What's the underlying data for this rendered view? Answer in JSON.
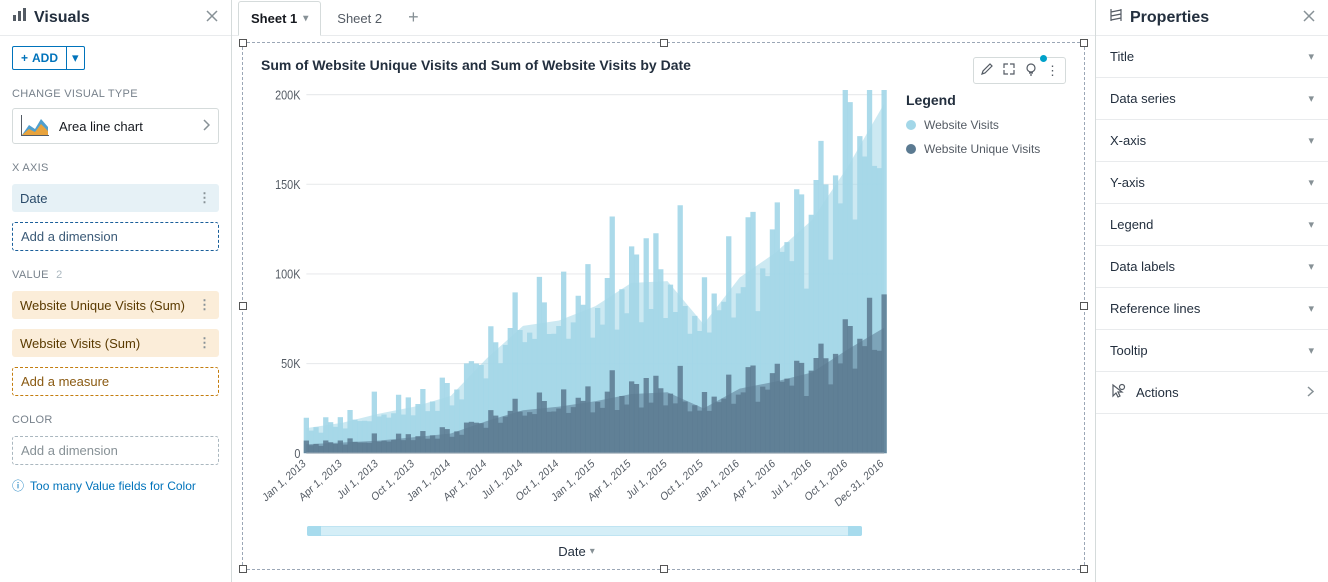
{
  "left": {
    "title": "Visuals",
    "add_label": "ADD",
    "change_type_label": "CHANGE VISUAL TYPE",
    "visual_type": "Area line chart",
    "xaxis_label": "X AXIS",
    "xaxis_field": "Date",
    "xaxis_add": "Add a dimension",
    "value_label": "VALUE",
    "value_count": "2",
    "value_fields": [
      "Website Unique Visits (Sum)",
      "Website Visits (Sum)"
    ],
    "value_add": "Add a measure",
    "color_label": "COLOR",
    "color_placeholder": "Add a dimension",
    "color_info": "Too many Value fields for Color"
  },
  "tabs": {
    "sheet1": "Sheet 1",
    "sheet2": "Sheet 2"
  },
  "chart": {
    "title": "Sum of Website Unique Visits and Sum of Website Visits by Date",
    "legend_title": "Legend",
    "series1_name": "Website Visits",
    "series2_name": "Website Unique Visits",
    "xaxis_title": "Date"
  },
  "props": {
    "title": "Properties",
    "items": [
      "Title",
      "Data series",
      "X-axis",
      "Y-axis",
      "Legend",
      "Data labels",
      "Reference lines",
      "Tooltip"
    ],
    "actions": "Actions"
  },
  "chart_data": {
    "type": "area",
    "title": "Sum of Website Unique Visits and Sum of Website Visits by Date",
    "xlabel": "Date",
    "ylabel": "",
    "ylim": [
      0,
      200000
    ],
    "yticks": [
      "0",
      "50K",
      "100K",
      "150K",
      "200K"
    ],
    "x_categories": [
      "Jan 1, 2013",
      "Apr 1, 2013",
      "Jul 1, 2013",
      "Oct 1, 2013",
      "Jan 1, 2014",
      "Apr 1, 2014",
      "Jul 1, 2014",
      "Oct 1, 2014",
      "Jan 1, 2015",
      "Apr 1, 2015",
      "Jul 1, 2015",
      "Oct 1, 2015",
      "Jan 1, 2016",
      "Apr 1, 2016",
      "Jul 1, 2016",
      "Oct 1, 2016",
      "Dec 31, 2016"
    ],
    "series": [
      {
        "name": "Website Visits",
        "color": "#a3d7e8",
        "values": [
          14000,
          17000,
          22000,
          26000,
          32000,
          53000,
          71000,
          74000,
          82000,
          95000,
          96000,
          72000,
          98000,
          112000,
          130000,
          160000,
          195000
        ]
      },
      {
        "name": "Website Unique Visits",
        "color": "#5b7a91",
        "values": [
          5000,
          6000,
          7000,
          9000,
          11000,
          18000,
          24000,
          26000,
          29000,
          33000,
          34000,
          25000,
          36000,
          40000,
          45000,
          58000,
          70000
        ]
      }
    ]
  }
}
